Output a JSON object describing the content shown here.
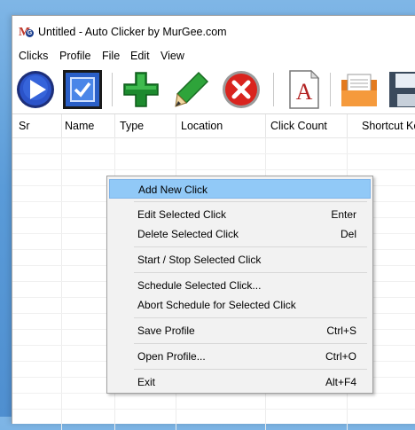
{
  "window": {
    "title": "Untitled - Auto Clicker by MurGee.com"
  },
  "menubar": [
    "Clicks",
    "Profile",
    "File",
    "Edit",
    "View"
  ],
  "toolbar": {
    "buttons": [
      "play-icon",
      "checkbox-icon",
      "add-icon",
      "edit-pencil-icon",
      "delete-icon",
      "document-icon",
      "open-folder-icon",
      "save-disk-icon"
    ]
  },
  "table": {
    "columns": [
      "Sr",
      "Name",
      "Type",
      "Location",
      "Click Count",
      "Shortcut Ke"
    ]
  },
  "context_menu": {
    "items": [
      {
        "label": "Add New Click",
        "shortcut": ""
      },
      {
        "label": "Edit Selected Click",
        "shortcut": "Enter"
      },
      {
        "label": "Delete Selected Click",
        "shortcut": "Del"
      },
      {
        "label": "Start / Stop Selected Click",
        "shortcut": ""
      },
      {
        "label": "Schedule Selected Click...",
        "shortcut": ""
      },
      {
        "label": "Abort Schedule for Selected Click",
        "shortcut": ""
      },
      {
        "label": "Save Profile",
        "shortcut": "Ctrl+S"
      },
      {
        "label": "Open Profile...",
        "shortcut": "Ctrl+O"
      },
      {
        "label": "Exit",
        "shortcut": "Alt+F4"
      }
    ]
  }
}
